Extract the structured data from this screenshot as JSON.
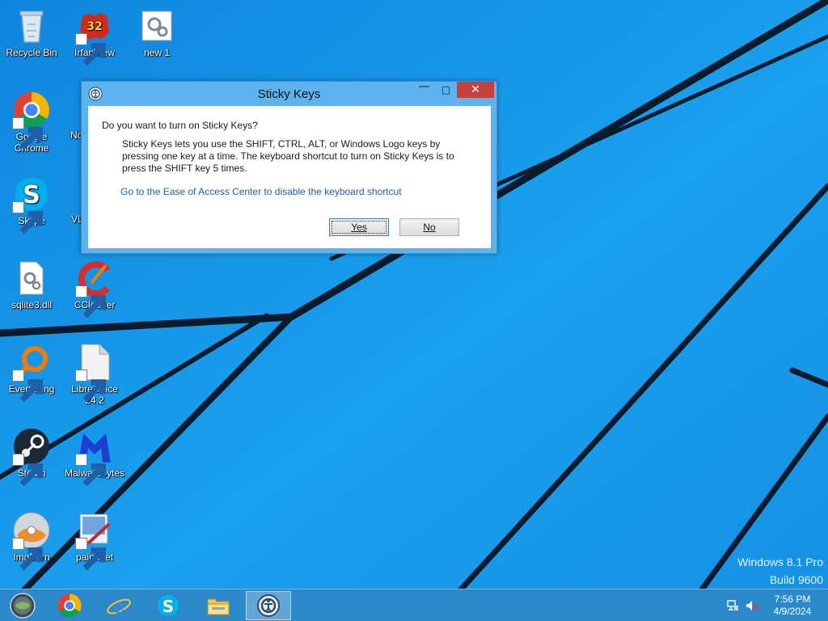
{
  "desktop": {
    "icons": [
      {
        "label": "Recycle Bin"
      },
      {
        "label": "IrfanView"
      },
      {
        "label": "new 1"
      },
      {
        "label": "Google Chrome"
      },
      {
        "label": "No"
      },
      {
        "label": "Skype"
      },
      {
        "label": "VL"
      },
      {
        "label": "sqlite3.dll"
      },
      {
        "label": "CCleaner"
      },
      {
        "label": "Everything"
      },
      {
        "label": "LibreOffice 24.2"
      },
      {
        "label": "Steam"
      },
      {
        "label": "Malwarebytes"
      },
      {
        "label": "ImgBurn"
      },
      {
        "label": "paint.net"
      }
    ],
    "irfanview_badge": "32"
  },
  "dialog": {
    "title": "Sticky Keys",
    "question": "Do you want to turn on Sticky Keys?",
    "description": "Sticky Keys lets you use the SHIFT, CTRL, ALT, or Windows Logo keys by pressing one key at a time. The keyboard shortcut to turn on Sticky Keys is to press the SHIFT key 5 times.",
    "link": "Go to the Ease of Access Center to disable the keyboard shortcut",
    "yes_label": "Yes",
    "no_label": "No",
    "minimize_glyph": "—",
    "maximize_glyph": "□",
    "close_glyph": "✕"
  },
  "watermark": {
    "line1": "Windows 8.1 Pro",
    "line2": "Build 9600"
  },
  "taskbar": {
    "items": [
      "start-orb-icon",
      "chrome-icon",
      "internet-explorer-icon",
      "skype-icon",
      "file-explorer-icon",
      "ease-of-access-icon"
    ],
    "time": "7:56 PM",
    "date": "4/9/2024"
  },
  "colors": {
    "wallpaper": "#1394e6",
    "taskbar": "#2c89c9",
    "dialog_frame": "#5cb3ee",
    "close_button": "#c7413a",
    "link": "#1f5fa8"
  }
}
